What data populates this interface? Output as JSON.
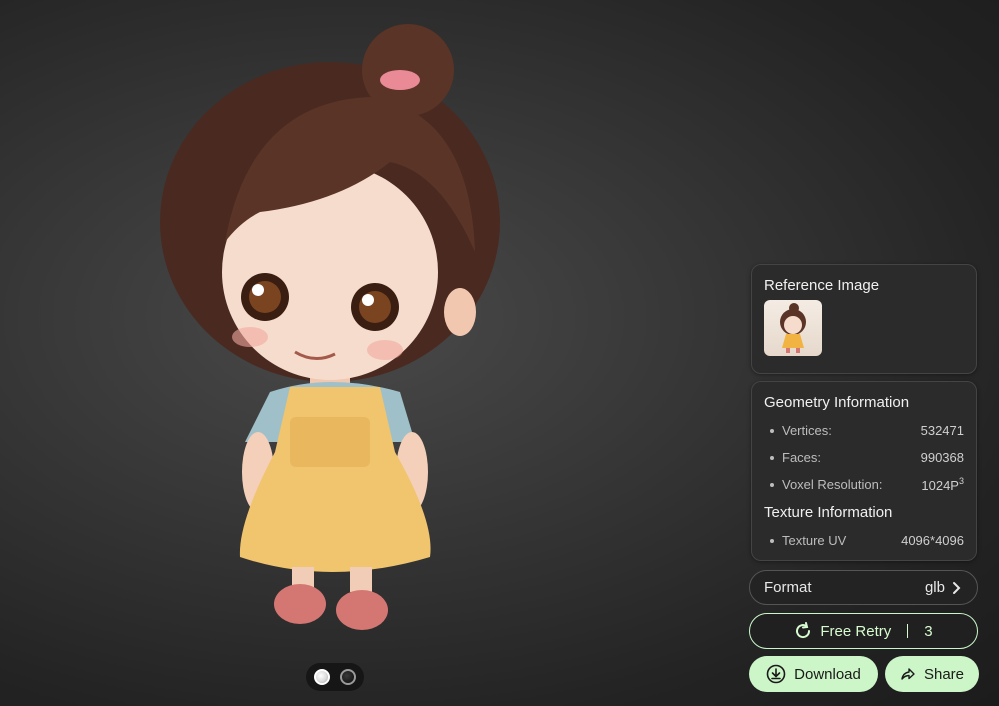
{
  "reference": {
    "title": "Reference Image"
  },
  "geometry": {
    "title": "Geometry Information",
    "rows": [
      {
        "label": "Vertices:",
        "value": "532471"
      },
      {
        "label": "Faces:",
        "value": "990368"
      },
      {
        "label": "Voxel Resolution:",
        "value": "1024P",
        "sup": "3"
      }
    ]
  },
  "texture": {
    "title": "Texture Information",
    "rows": [
      {
        "label": "Texture UV",
        "value": "4096*4096"
      }
    ]
  },
  "format": {
    "label": "Format",
    "value": "glb"
  },
  "retry": {
    "label": "Free Retry",
    "count": "3"
  },
  "actions": {
    "download": "Download",
    "share": "Share"
  },
  "icons": [
    "chevron-right-icon",
    "refresh-icon",
    "download-icon",
    "share-icon"
  ],
  "colors": {
    "accent": "#cdf6c8",
    "panel": "#2b2b2b",
    "background": "#2a2a2a"
  }
}
